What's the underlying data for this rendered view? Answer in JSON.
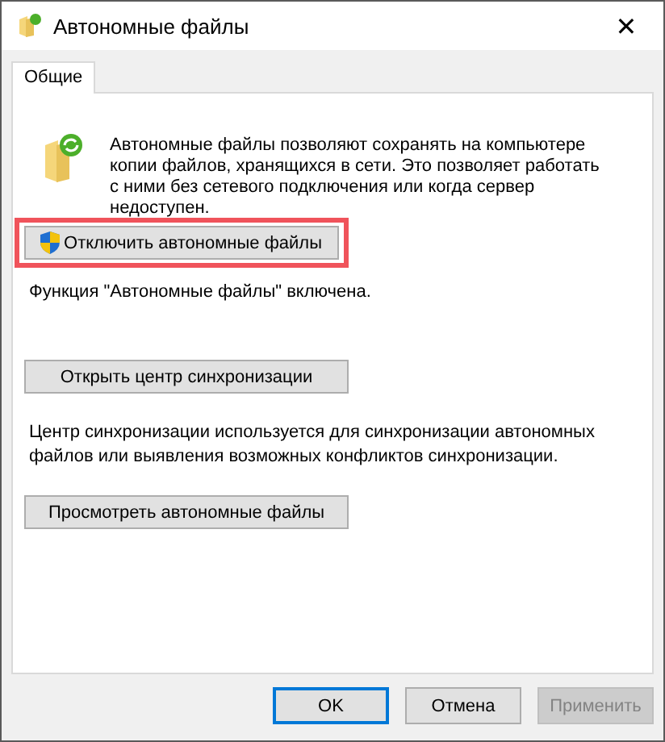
{
  "window": {
    "title": "Автономные файлы",
    "close": "✕"
  },
  "tabs": [
    {
      "label": "Общие",
      "selected": true
    }
  ],
  "intro": "Автономные файлы позволяют сохранять на компьютере копии файлов, хранящихся в сети.  Это позволяет работать с ними без сетевого подключения или когда сервер недоступен.",
  "sections": [
    {
      "kind": "toggle",
      "button": "Отключить автономные файлы",
      "highlighted": true,
      "shield": true,
      "note": "Функция \"Автономные файлы\" включена."
    },
    {
      "kind": "sync",
      "button": "Открыть центр синхронизации",
      "highlighted": false,
      "shield": false,
      "note": "Центр синхронизации используется для синхронизации автономных файлов или выявления возможных конфликтов синхронизации."
    },
    {
      "kind": "view",
      "button": "Просмотреть автономные файлы",
      "highlighted": false,
      "shield": false
    }
  ],
  "dialog_buttons": [
    {
      "label": "OK",
      "default": true,
      "disabled": false
    },
    {
      "label": "Отмена",
      "default": false,
      "disabled": false
    },
    {
      "label": "Применить",
      "default": false,
      "disabled": true
    }
  ]
}
